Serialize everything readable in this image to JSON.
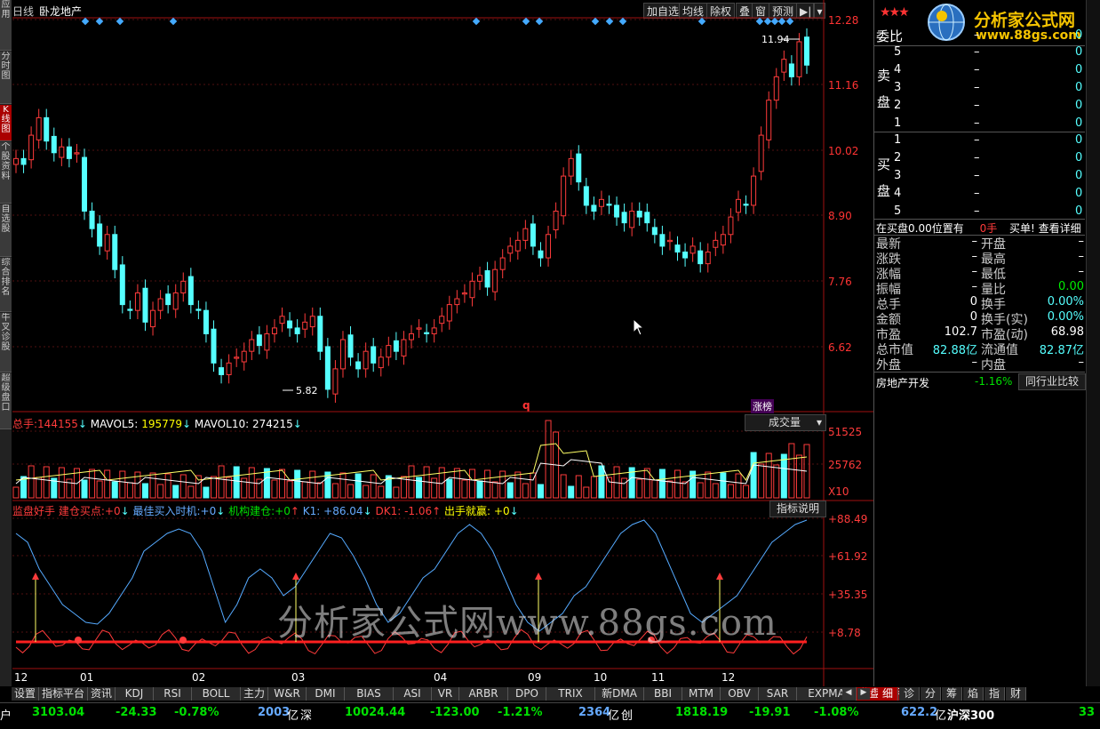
{
  "app": {
    "period": "日线",
    "stock_name": "卧龙地产"
  },
  "toolbar": {
    "add_watch": "加自选",
    "avg_line": "均线",
    "exright": "除权",
    "overlay": "叠",
    "window": "窗",
    "forecast": "预测",
    "expand_icon": "collapse-icon",
    "menu_icon": "dropdown-icon"
  },
  "sidebar": {
    "items": [
      "应用",
      "分时图",
      "K线图",
      "个股资料",
      "自选股",
      "综合排名",
      "牛叉诊股",
      "超级盘口"
    ],
    "active": 2
  },
  "price_axis": {
    "ticks": [
      "12.28",
      "11.16",
      "10.02",
      "8.90",
      "7.76",
      "6.62"
    ]
  },
  "price_annotations": {
    "high": "11.94",
    "low": "5.82"
  },
  "markers": {
    "q": "q",
    "zhangbang": "涨榜"
  },
  "volume_panel": {
    "label_total": "总手:",
    "total_value": "144155",
    "mavol5_label": "MAVOL5:",
    "mavol5_value": "195779",
    "mavol10_label": "MAVOL10:",
    "mavol10_value": "274215",
    "dropdown": "成交量",
    "ticks": [
      "51525",
      "25762"
    ],
    "unit": "X10"
  },
  "indicator_panel": {
    "name": "监盘好手",
    "build_label": "建仓买点:",
    "build_value": "+0",
    "best_label": "最佳买入时机:",
    "best_value": "+0",
    "inst_label": "机构建仓:",
    "inst_value": "+0",
    "k1_label": "K1:",
    "k1_value": "+86.04",
    "dk1_label": "DK1:",
    "dk1_value": "-1.06",
    "exit_label": "出手就赢:",
    "exit_value": "+0",
    "help_button": "指标说明",
    "ticks": [
      "+88.49",
      "+61.92",
      "+35.35",
      "+8.78"
    ]
  },
  "watermark": "分析家公式网www.88gs.com",
  "date_axis": [
    "12",
    "01",
    "02",
    "03",
    "04",
    "09",
    "10",
    "11",
    "12"
  ],
  "bottom_tabs": [
    "设置",
    "指标平台",
    "资讯",
    "KDJ",
    "RSI",
    "BOLL",
    "主力",
    "W&R",
    "DMI",
    "BIAS",
    "ASI",
    "VR",
    "ARBR",
    "DPO",
    "TRIX",
    "新DMA",
    "BBI",
    "MTM",
    "OBV",
    "SAR",
    "EXPMA",
    "监盘好手"
  ],
  "bottom_tabs_active": 21,
  "right_tabs": [
    "细",
    "诊",
    "分",
    "筹",
    "焰",
    "指",
    "财"
  ],
  "logo": {
    "title": "分析家公式网",
    "url": "www.88gs.com"
  },
  "order_book": {
    "weibi_label": "委比",
    "weibi_value": "–",
    "weibi_num": "0",
    "sell_label": "卖盘",
    "buy_label": "买盘",
    "sell_rows": [
      {
        "lvl": "5",
        "price": "–",
        "vol": "0"
      },
      {
        "lvl": "4",
        "price": "–",
        "vol": "0"
      },
      {
        "lvl": "3",
        "price": "–",
        "vol": "0"
      },
      {
        "lvl": "2",
        "price": "–",
        "vol": "0"
      },
      {
        "lvl": "1",
        "price": "–",
        "vol": "0"
      }
    ],
    "buy_rows": [
      {
        "lvl": "1",
        "price": "–",
        "vol": "0"
      },
      {
        "lvl": "2",
        "price": "–",
        "vol": "0"
      },
      {
        "lvl": "3",
        "price": "–",
        "vol": "0"
      },
      {
        "lvl": "4",
        "price": "–",
        "vol": "0"
      },
      {
        "lvl": "5",
        "price": "–",
        "vol": "0"
      }
    ]
  },
  "order_info": {
    "text": "在买盘0.00位置有",
    "hands": "0手",
    "buy_link": "买单!",
    "detail_link": "查看详细"
  },
  "quote": [
    {
      "l": "最新",
      "lv": "–",
      "r": "开盘",
      "rv": "–"
    },
    {
      "l": "涨跌",
      "lv": "–",
      "r": "最高",
      "rv": "–"
    },
    {
      "l": "涨幅",
      "lv": "–",
      "r": "最低",
      "rv": "–"
    },
    {
      "l": "振幅",
      "lv": "–",
      "r": "量比",
      "rv": "0.00"
    },
    {
      "l": "总手",
      "lv": "0",
      "r": "换手",
      "rv": "0.00%"
    },
    {
      "l": "金额",
      "lv": "0",
      "r": "换手(实)",
      "rv": "0.00%"
    },
    {
      "l": "市盈",
      "lv": "102.7",
      "r": "市盈(动)",
      "rv": "68.98"
    },
    {
      "l": "总市值",
      "lv": "82.88亿",
      "r": "流通值",
      "rv": "82.87亿"
    },
    {
      "l": "外盘",
      "lv": "–",
      "r": "内盘",
      "rv": "–"
    }
  ],
  "industry": {
    "name": "房地产开发",
    "change": "-1.16%",
    "compare_button": "同行业比较"
  },
  "status_bar": {
    "sh_index": "3103.04",
    "sh_change": "-24.33",
    "sh_pct": "-0.78%",
    "sh_amount": "2003",
    "sz_label": "深",
    "sz_index": "10024.44",
    "sz_change": "-123.00",
    "sz_pct": "-1.21%",
    "sz_amount": "2364",
    "cy_label": "创",
    "cy_index": "1818.19",
    "cy_change": "-19.91",
    "cy_pct": "-1.08%",
    "hs_amount": "622.2",
    "hs_label": "沪深300",
    "hs_value": "33",
    "yi": "亿",
    "left_glyph": "户"
  },
  "colors": {
    "up": "#ff3b3b",
    "down": "#55ffff",
    "ma5": "#ffff66",
    "ma10": "#ffffff",
    "k1": "#55aaff",
    "dk1": "#ff3b3b"
  }
}
